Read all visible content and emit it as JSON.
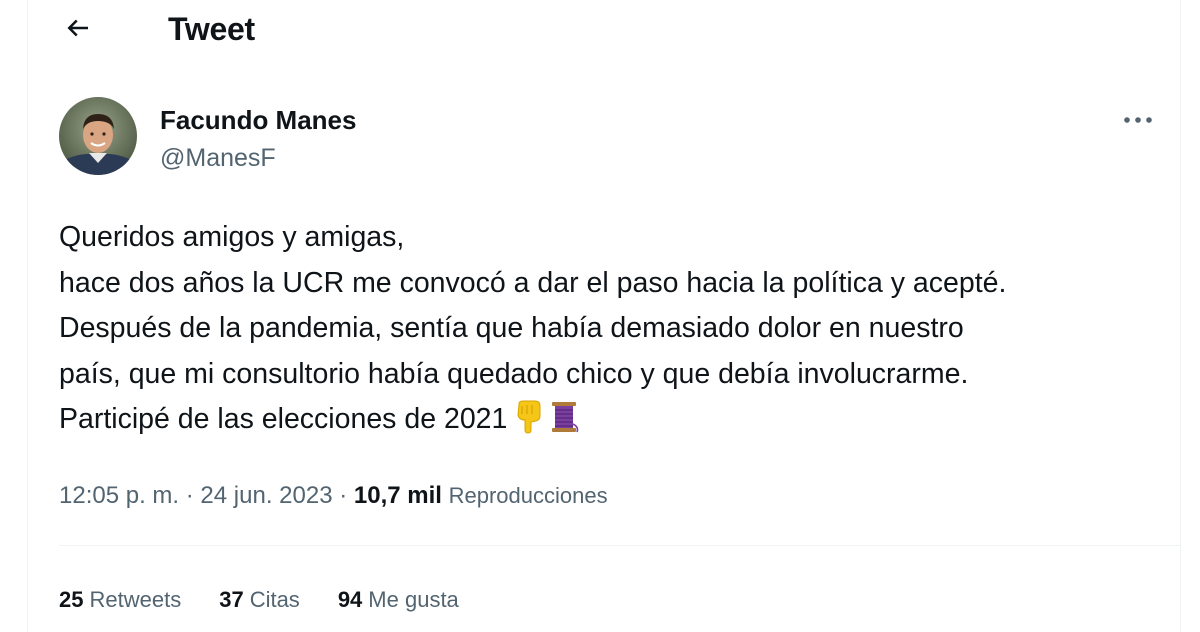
{
  "header": {
    "title": "Tweet",
    "back_icon": "arrow-left-icon"
  },
  "author": {
    "name": "Facundo Manes",
    "handle": "@ManesF",
    "more_icon": "more-horizontal-icon"
  },
  "tweet": {
    "lines": [
      "Queridos amigos y amigas,",
      "hace dos años la UCR me convocó a dar el paso hacia la política y acepté.",
      "Después de la pandemia, sentía que había demasiado dolor en nuestro",
      "país, que mi consultorio había quedado chico y que debía involucrarme.",
      "Participé de las elecciones de 2021"
    ],
    "emojis": [
      "backhand-index-pointing-down-icon",
      "thread-spool-icon"
    ]
  },
  "meta": {
    "time": "12:05 p. m.",
    "separator": "·",
    "date": "24 jun. 2023",
    "views_count": "10,7 mil",
    "views_label": "Reproducciones"
  },
  "stats": {
    "retweets_count": "25",
    "retweets_label": "Retweets",
    "quotes_count": "37",
    "quotes_label": "Citas",
    "likes_count": "94",
    "likes_label": "Me gusta"
  },
  "colors": {
    "text_primary": "#0f1419",
    "text_secondary": "#536471",
    "divider": "#eff3f4"
  }
}
